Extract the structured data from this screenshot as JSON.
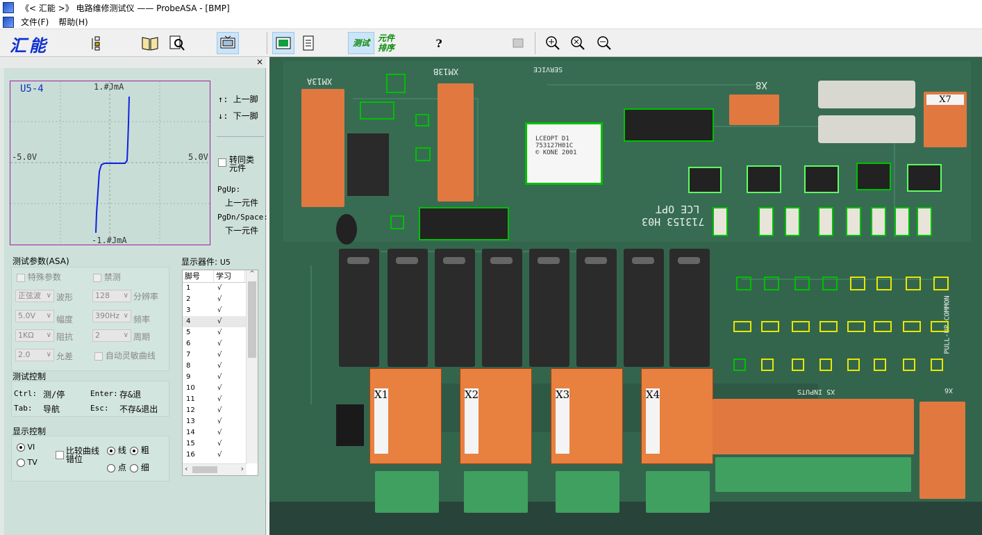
{
  "window": {
    "title": "《< 汇能 >》 电路维修测试仪 —— ProbeASA - [BMP]"
  },
  "menu": {
    "file": "文件(F)",
    "help": "帮助(H)"
  },
  "toolbar": {
    "brand": "汇能",
    "test_label": "测试",
    "sort_label_1": "元件",
    "sort_label_2": "排序"
  },
  "scope": {
    "title": "U5-4",
    "y_top": "1.#JmA",
    "y_bottom": "-1.#JmA",
    "x_left": "-5.0V",
    "x_right": "5.0V"
  },
  "nav": {
    "up_label": "↑: 上一脚",
    "down_label": "↓: 下一脚",
    "same_type_1": "转同类",
    "same_type_2": "元件",
    "pgup": "PgUp:",
    "prev_comp": "上一元件",
    "pgdn": "PgDn/Space:",
    "next_comp": "下一元件"
  },
  "test_params": {
    "title": "测试参数(ASA)",
    "special": "特殊参数",
    "disable": "禁测",
    "waveform_value": "正弦波",
    "waveform_label": "波形",
    "resolution_value": "128",
    "resolution_label": "分辨率",
    "amplitude_value": "5.0V",
    "amplitude_label": "幅度",
    "freq_value": "390Hz",
    "freq_label": "频率",
    "imp_value": "1KΩ",
    "imp_label": "阻抗",
    "period_value": "2",
    "period_label": "周期",
    "tol_value": "2.0",
    "tol_label": "允差",
    "auto_curve": "自动灵敏曲线"
  },
  "test_ctrl": {
    "title": "测试控制",
    "ctrl": "Ctrl:",
    "ctrl_action": "测/停",
    "enter": "Enter:",
    "enter_action": "存&退",
    "tab": "Tab:",
    "tab_action": "导航",
    "esc": "Esc:",
    "esc_action": "不存&退出"
  },
  "display_ctrl": {
    "title": "显示控制",
    "vi": "VI",
    "tv": "TV",
    "compare_1": "比较曲线",
    "compare_2": "错位",
    "line": "线",
    "dot": "点",
    "thick": "粗",
    "thin": "细"
  },
  "device": {
    "label": "显示器件:",
    "name": "U5"
  },
  "pins": {
    "header_pin": "脚号",
    "header_learn": "学习",
    "rows": [
      {
        "pin": "1",
        "learn": "√"
      },
      {
        "pin": "2",
        "learn": "√"
      },
      {
        "pin": "3",
        "learn": "√"
      },
      {
        "pin": "4",
        "learn": "√"
      },
      {
        "pin": "5",
        "learn": "√"
      },
      {
        "pin": "6",
        "learn": "√"
      },
      {
        "pin": "7",
        "learn": "√"
      },
      {
        "pin": "8",
        "learn": "√"
      },
      {
        "pin": "9",
        "learn": "√"
      },
      {
        "pin": "10",
        "learn": "√"
      },
      {
        "pin": "11",
        "learn": "√"
      },
      {
        "pin": "12",
        "learn": "√"
      },
      {
        "pin": "13",
        "learn": "√"
      },
      {
        "pin": "14",
        "learn": "√"
      },
      {
        "pin": "15",
        "learn": "√"
      },
      {
        "pin": "16",
        "learn": "√"
      }
    ]
  },
  "board": {
    "xm13a": "XM13A",
    "xm13b": "XM13B",
    "x8": "X8",
    "x7": "X7",
    "chip_1": "LCEOPT D1",
    "chip_2": "753127H01C",
    "chip_3": "© KONE 2001",
    "lce": "LCE OPT",
    "model": "713153 H03",
    "x1": "X1",
    "x2": "X2",
    "x3": "X3",
    "x4": "X4",
    "x5": "X5 INPUTS",
    "x6": "X6",
    "pullup": "PULL-UP COMMON",
    "service": "SERVICE"
  }
}
